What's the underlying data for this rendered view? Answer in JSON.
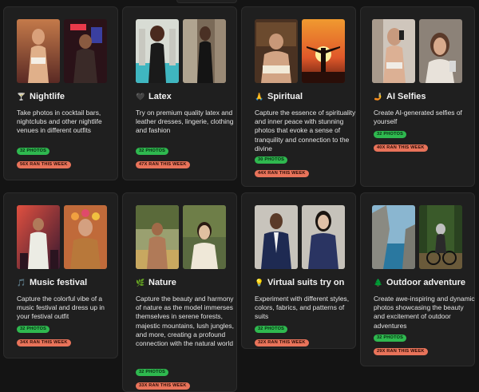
{
  "cards": [
    {
      "icon": "🍸",
      "title": "Nightlife",
      "description": "Take photos in cocktail bars, nightclubs and other nightlife venues in different outfits",
      "photos": "32 PHOTOS",
      "runs": "56X RAN THIS WEEK",
      "icon_name": "cocktail-icon"
    },
    {
      "icon": "🖤",
      "title": "Latex",
      "description": "Try on premium quality latex and leather dresses, lingerie, clothing and fashion",
      "photos": "32 PHOTOS",
      "runs": "47X RAN THIS WEEK",
      "icon_name": "black-heart-icon"
    },
    {
      "icon": "🙏",
      "title": "Spiritual",
      "description": "Capture the essence of spirituality and inner peace with stunning photos that evoke a sense of tranquility and connection to the divine",
      "photos": "30 PHOTOS",
      "runs": "44X RAN THIS WEEK",
      "icon_name": "praying-hands-icon"
    },
    {
      "icon": "🤳",
      "title": "AI Selfies",
      "description": "Create AI-generated selfies of yourself",
      "photos": "32 PHOTOS",
      "runs": "40X RAN THIS WEEK",
      "icon_name": "selfie-icon"
    },
    {
      "icon": "🎵",
      "title": "Music festival",
      "description": "Capture the colorful vibe of a music festival and dress up in your festival outfit",
      "photos": "32 PHOTOS",
      "runs": "34X RAN THIS WEEK",
      "icon_name": "music-note-icon"
    },
    {
      "icon": "🌿",
      "title": "Nature",
      "description": "Capture the beauty and harmony of nature as the model immerses themselves in serene forests, majestic mountains, lush jungles, and more, creating a profound connection with the natural world",
      "photos": "32 PHOTOS",
      "runs": "33X RAN THIS WEEK",
      "icon_name": "leaf-icon"
    },
    {
      "icon": "💡",
      "title": "Virtual suits try on",
      "description": "Experiment with different styles, colors, fabrics, and patterns of suits",
      "photos": "32 PHOTOS",
      "runs": "32X RAN THIS WEEK",
      "icon_name": "light-bulb-icon"
    },
    {
      "icon": "🌲",
      "title": "Outdoor adventure",
      "description": "Create awe-inspiring and dynamic photos showcasing the beauty and excitement of outdoor adventures",
      "photos": "32 PHOTOS",
      "runs": "29X RAN THIS WEEK",
      "icon_name": "tree-icon"
    }
  ],
  "colors": {
    "photos_badge": "#2fb84f",
    "runs_badge": "#e8735a",
    "card_bg": "#1f1f1f",
    "page_bg": "#141414"
  }
}
